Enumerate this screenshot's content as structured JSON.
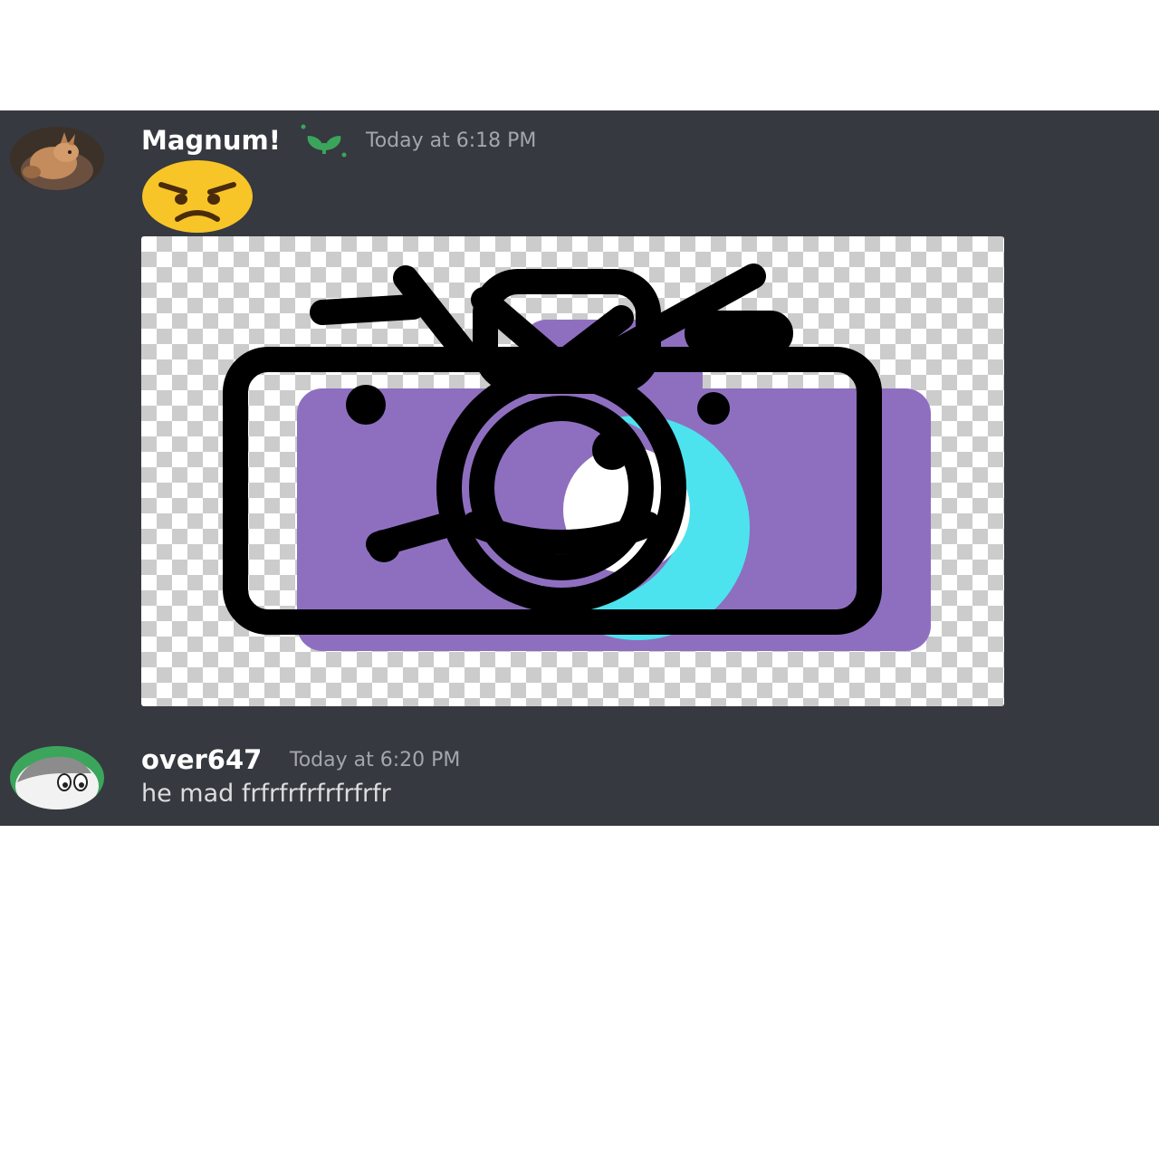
{
  "messages": [
    {
      "username": "Magnum!",
      "badge_icon": "sprout-badge-icon",
      "timestamp": "Today at 6:18 PM",
      "emoji": "angry-face-emoji",
      "attachment": "camera-logo-image"
    },
    {
      "username": "over647",
      "timestamp": "Today at 6:20 PM",
      "text": "he mad frfrfrfrfrfrfrfr"
    }
  ],
  "colors": {
    "chat_background": "#36393f",
    "username": "#ffffff",
    "timestamp": "#a3a6aa",
    "message_text": "#dcddde",
    "badge_green": "#3ba55c",
    "camera_purple": "#8e6fbf",
    "camera_cyan": "#4de3ee",
    "emoji_yellow": "#f7c528"
  }
}
